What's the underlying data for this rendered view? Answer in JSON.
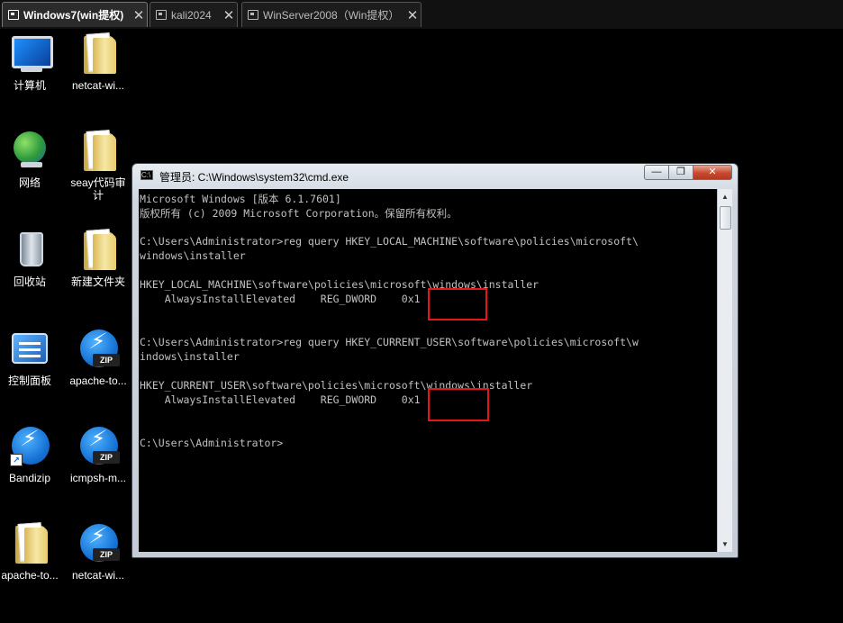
{
  "tabs": [
    {
      "label": "Windows7(win提权)",
      "close": "✕"
    },
    {
      "label": "kali2024",
      "close": "✕"
    },
    {
      "label": "WinServer2008（Win提权）",
      "close": "✕"
    }
  ],
  "desktop_icons": [
    {
      "label": "计算机"
    },
    {
      "label": "netcat-wi..."
    },
    {
      "label": "网络"
    },
    {
      "label": "seay代码审\n计"
    },
    {
      "label": "回收站"
    },
    {
      "label": "新建文件夹"
    },
    {
      "label": "控制面板"
    },
    {
      "label": "apache-to..."
    },
    {
      "label": "Bandizip"
    },
    {
      "label": "icmpsh-m..."
    },
    {
      "label": "apache-to..."
    },
    {
      "label": "netcat-wi..."
    }
  ],
  "zip_tag": "ZIP",
  "window": {
    "title": "管理员: C:\\Windows\\system32\\cmd.exe",
    "minimize": "—",
    "maximize": "❐",
    "close": "✕"
  },
  "console_lines": [
    "Microsoft Windows [版本 6.1.7601]",
    "版权所有 (c) 2009 Microsoft Corporation。保留所有权利。",
    "C:\\Users\\Administrator>reg query HKEY_LOCAL_MACHINE\\software\\policies\\microsoft\\",
    "windows\\installer",
    "HKEY_LOCAL_MACHINE\\software\\policies\\microsoft\\windows\\installer",
    "    AlwaysInstallElevated    REG_DWORD    0x1",
    "C:\\Users\\Administrator>reg query HKEY_CURRENT_USER\\software\\policies\\microsoft\\w",
    "indows\\installer",
    "HKEY_CURRENT_USER\\software\\policies\\microsoft\\windows\\installer",
    "    AlwaysInstallElevated    REG_DWORD    0x1",
    "C:\\Users\\Administrator>"
  ],
  "colors": {
    "highlight": "#e4151b",
    "console_text": "#c0c0c0",
    "console_bg": "#000000"
  }
}
